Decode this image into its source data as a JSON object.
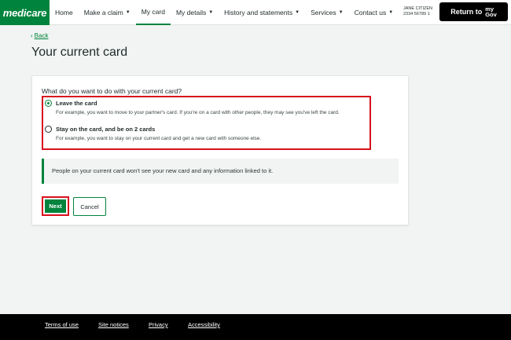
{
  "header": {
    "logo": "medicare",
    "nav": [
      {
        "label": "Home",
        "caret": false
      },
      {
        "label": "Make a claim",
        "caret": true
      },
      {
        "label": "My card",
        "caret": false
      },
      {
        "label": "My details",
        "caret": true
      },
      {
        "label": "History and statements",
        "caret": true
      },
      {
        "label": "Services",
        "caret": true
      },
      {
        "label": "Contact us",
        "caret": true
      }
    ],
    "user_name": "JANE CITIZEN",
    "user_number": "2334 56789 1",
    "return_label": "Return to",
    "mygov_top": "my",
    "mygov_bottom": "Gov"
  },
  "page": {
    "back_label": "Back",
    "title": "Your current card"
  },
  "form": {
    "question": "What do you want to do with your current card?",
    "options": [
      {
        "label": "Leave the card",
        "hint": "For example, you want to move to your partner's card. If you're on a card with other people, they may see you've left the card.",
        "selected": true
      },
      {
        "label": "Stay on the card, and be on 2 cards",
        "hint": "For example, you want to stay on your current card and get a new card with someone else.",
        "selected": false
      }
    ],
    "info": "People on your current card won't see your new card and any information linked to it.",
    "next_label": "Next",
    "cancel_label": "Cancel"
  },
  "footer": {
    "links": [
      "Terms of use",
      "Site notices",
      "Privacy",
      "Accessibility"
    ]
  },
  "colors": {
    "brand_green": "#00843d",
    "highlight_red": "#d80f1e",
    "footer_bg": "#000000",
    "page_bg": "#f1f4f2"
  }
}
